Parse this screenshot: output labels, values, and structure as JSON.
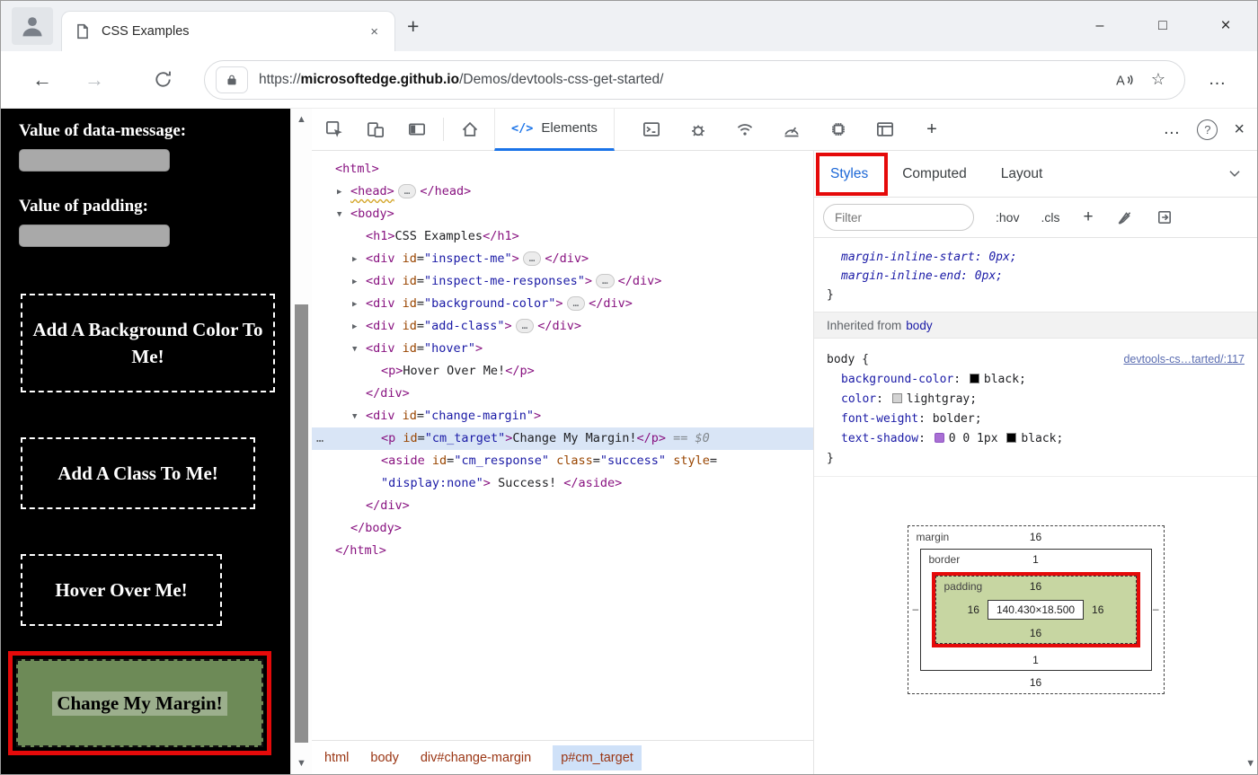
{
  "browser": {
    "tab_title": "CSS Examples",
    "tab_close": "×",
    "new_tab": "+",
    "controls": {
      "minimize": "–",
      "maximize": "□",
      "close": "×"
    },
    "nav": {
      "back": "←",
      "forward": "→"
    },
    "url": {
      "scheme": "https://",
      "domain": "microsoftedge.github.io",
      "path": "/Demos/devtools-css-get-started/"
    },
    "icons": {
      "favorite": "☆",
      "settings": "…"
    }
  },
  "page": {
    "data_message_label": "Value of data-message:",
    "padding_label": "Value of padding:",
    "buttons": {
      "background": "Add A Background Color To Me!",
      "class": "Add A Class To Me!",
      "hover": "Hover Over Me!",
      "margin": "Change My Margin!"
    }
  },
  "devtools": {
    "toolbar": {
      "elements_tab": "Elements",
      "more": "…",
      "help": "?",
      "close": "×",
      "add_tools": "+"
    },
    "arrows": {
      "collapsed": "▶",
      "expanded": "▼"
    },
    "gutter": "…",
    "scroll": {
      "up": "▲",
      "down": "▼"
    },
    "dom_lines": [
      {
        "ind": 0,
        "tok": [
          [
            "t",
            "<html>"
          ]
        ]
      },
      {
        "ind": 1,
        "arrow": "r",
        "tok": [
          [
            "w",
            "<head>"
          ],
          [
            "b",
            "…"
          ],
          [
            "t",
            "</head>"
          ]
        ]
      },
      {
        "ind": 1,
        "arrow": "d",
        "tok": [
          [
            "t",
            "<body>"
          ]
        ]
      },
      {
        "ind": 2,
        "tok": [
          [
            "t",
            "<h1>"
          ],
          [
            "x",
            "CSS Examples"
          ],
          [
            "t",
            "</h1>"
          ]
        ]
      },
      {
        "ind": 2,
        "arrow": "r",
        "tok": [
          [
            "t",
            "<div"
          ],
          [
            "a",
            " id"
          ],
          [
            "x",
            "="
          ],
          [
            "v",
            "\"inspect-me\""
          ],
          [
            "t",
            ">"
          ],
          [
            "b",
            "…"
          ],
          [
            "t",
            "</div>"
          ]
        ]
      },
      {
        "ind": 2,
        "arrow": "r",
        "tok": [
          [
            "t",
            "<div"
          ],
          [
            "a",
            " id"
          ],
          [
            "x",
            "="
          ],
          [
            "v",
            "\"inspect-me-responses\""
          ],
          [
            "t",
            ">"
          ],
          [
            "b",
            "…"
          ],
          [
            "t",
            "</div>"
          ]
        ]
      },
      {
        "ind": 2,
        "arrow": "r",
        "tok": [
          [
            "t",
            "<div"
          ],
          [
            "a",
            " id"
          ],
          [
            "x",
            "="
          ],
          [
            "v",
            "\"background-color\""
          ],
          [
            "t",
            ">"
          ],
          [
            "b",
            "…"
          ],
          [
            "t",
            "</div>"
          ]
        ]
      },
      {
        "ind": 2,
        "arrow": "r",
        "tok": [
          [
            "t",
            "<div"
          ],
          [
            "a",
            " id"
          ],
          [
            "x",
            "="
          ],
          [
            "v",
            "\"add-class\""
          ],
          [
            "t",
            ">"
          ],
          [
            "b",
            "…"
          ],
          [
            "t",
            "</div>"
          ]
        ]
      },
      {
        "ind": 2,
        "arrow": "d",
        "tok": [
          [
            "t",
            "<div"
          ],
          [
            "a",
            " id"
          ],
          [
            "x",
            "="
          ],
          [
            "v",
            "\"hover\""
          ],
          [
            "t",
            ">"
          ]
        ]
      },
      {
        "ind": 3,
        "tok": [
          [
            "t",
            "<p>"
          ],
          [
            "x",
            "Hover Over Me!"
          ],
          [
            "t",
            "</p>"
          ]
        ]
      },
      {
        "ind": 2,
        "tok": [
          [
            "t",
            "</div>"
          ]
        ]
      },
      {
        "ind": 2,
        "arrow": "d",
        "tok": [
          [
            "t",
            "<div"
          ],
          [
            "a",
            " id"
          ],
          [
            "x",
            "="
          ],
          [
            "v",
            "\"change-margin\""
          ],
          [
            "t",
            ">"
          ]
        ]
      },
      {
        "ind": 3,
        "sel": true,
        "gutter": true,
        "tok": [
          [
            "t",
            "<p"
          ],
          [
            "a",
            " id"
          ],
          [
            "x",
            "="
          ],
          [
            "v",
            "\"cm_target\""
          ],
          [
            "t",
            ">"
          ],
          [
            "x",
            "Change My Margin!"
          ],
          [
            "t",
            "</p>"
          ],
          [
            "i",
            " == $0"
          ]
        ]
      },
      {
        "ind": 3,
        "tok": [
          [
            "t",
            "<aside"
          ],
          [
            "a",
            " id"
          ],
          [
            "x",
            "="
          ],
          [
            "v",
            "\"cm_response\""
          ],
          [
            "a",
            " class"
          ],
          [
            "x",
            "="
          ],
          [
            "v",
            "\"success\""
          ],
          [
            "a",
            " style"
          ],
          [
            "x",
            "="
          ]
        ]
      },
      {
        "ind": 3,
        "tok": [
          [
            "v",
            "\"display:none\""
          ],
          [
            "t",
            ">"
          ],
          [
            "x",
            " Success! "
          ],
          [
            "t",
            "</aside>"
          ]
        ]
      },
      {
        "ind": 2,
        "tok": [
          [
            "t",
            "</div>"
          ]
        ]
      },
      {
        "ind": 1,
        "tok": [
          [
            "t",
            "</body>"
          ]
        ]
      },
      {
        "ind": 0,
        "tok": [
          [
            "t",
            "</html>"
          ]
        ]
      }
    ],
    "breadcrumbs": [
      {
        "label": "html"
      },
      {
        "label": "body"
      },
      {
        "label": "div#change-margin"
      },
      {
        "label": "p#cm_target",
        "selected": true
      }
    ],
    "styles": {
      "tabs": [
        {
          "label": "Styles",
          "active": true
        },
        {
          "label": "Computed"
        },
        {
          "label": "Layout"
        }
      ],
      "filter_placeholder": "Filter",
      "pseudo_button": ":hov",
      "class_button": ".cls",
      "new_rule_button": "+",
      "partial_rule": [
        {
          "text": "margin-inline-start: 0px;",
          "italic": true,
          "indent": true
        },
        {
          "text": "margin-inline-end: 0px;",
          "italic": true,
          "indent": true
        },
        {
          "text": "}",
          "italic": false
        }
      ],
      "inherited_label": "Inherited from",
      "inherited_link": "body",
      "rule": {
        "selector": "body",
        "open": "{",
        "close": "}",
        "source_link": "devtools-cs…tarted/:117",
        "declarations": [
          {
            "name": "background-color",
            "swatch": "#000000",
            "value": "black;"
          },
          {
            "name": "color",
            "swatch": "#d3d3d3",
            "value": "lightgray;"
          },
          {
            "name": "font-weight",
            "value": "bolder;"
          },
          {
            "name": "text-shadow",
            "shadow_icon": "#a96fd4",
            "value": "0 0 1px ",
            "swatch2": "#000000",
            "value2": "black;"
          }
        ]
      },
      "box_model": {
        "margin_label": "margin",
        "border_label": "border",
        "padding_label": "padding",
        "margin_top": "16",
        "margin_bottom": "16",
        "margin_left": "–",
        "margin_right": "–",
        "border_top": "1",
        "border_bottom": "1",
        "padding_top": "16",
        "padding_bottom": "16",
        "padding_left": "16",
        "padding_right": "16",
        "content": "140.430×18.500"
      }
    }
  }
}
